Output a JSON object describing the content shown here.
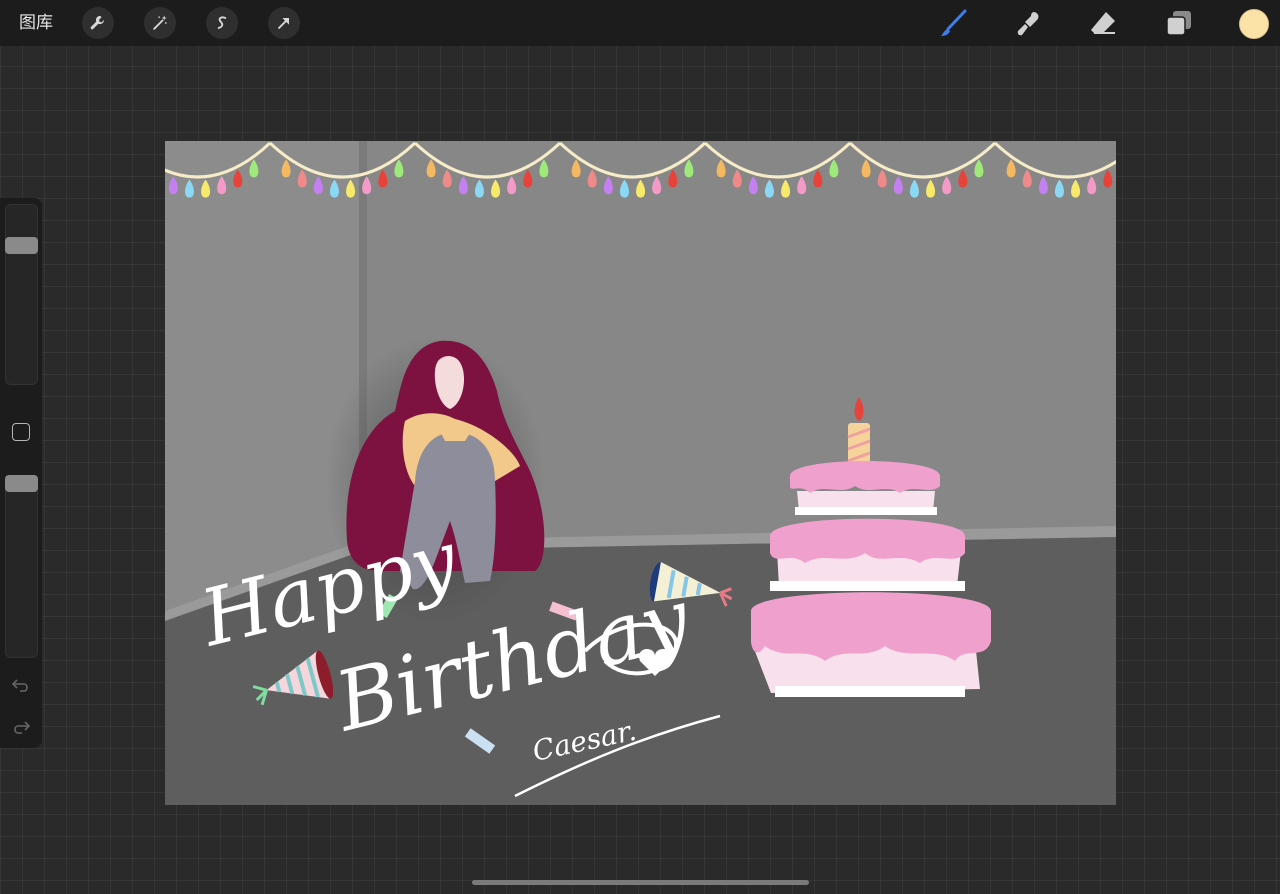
{
  "toolbar": {
    "gallery_label": "图库",
    "actions_icon": "wrench-icon",
    "adjustments_icon": "magic-wand-icon",
    "selection_icon": "selection-s-icon",
    "transform_icon": "arrow-cursor-icon"
  },
  "right_tools": {
    "brush_icon": "brush-icon",
    "smudge_icon": "smudge-icon",
    "eraser_icon": "eraser-icon",
    "layers_icon": "layers-icon",
    "active_color": "#fbe3a8",
    "active_tool_color": "#3d7ee8"
  },
  "sidebar": {
    "brush_size": 0.8,
    "opacity": 1.0,
    "undo_icon": "undo-icon",
    "redo_icon": "redo-icon"
  },
  "artwork": {
    "greeting_line1": "Happy",
    "greeting_line2": "Birthday",
    "signature": "Caesar."
  }
}
